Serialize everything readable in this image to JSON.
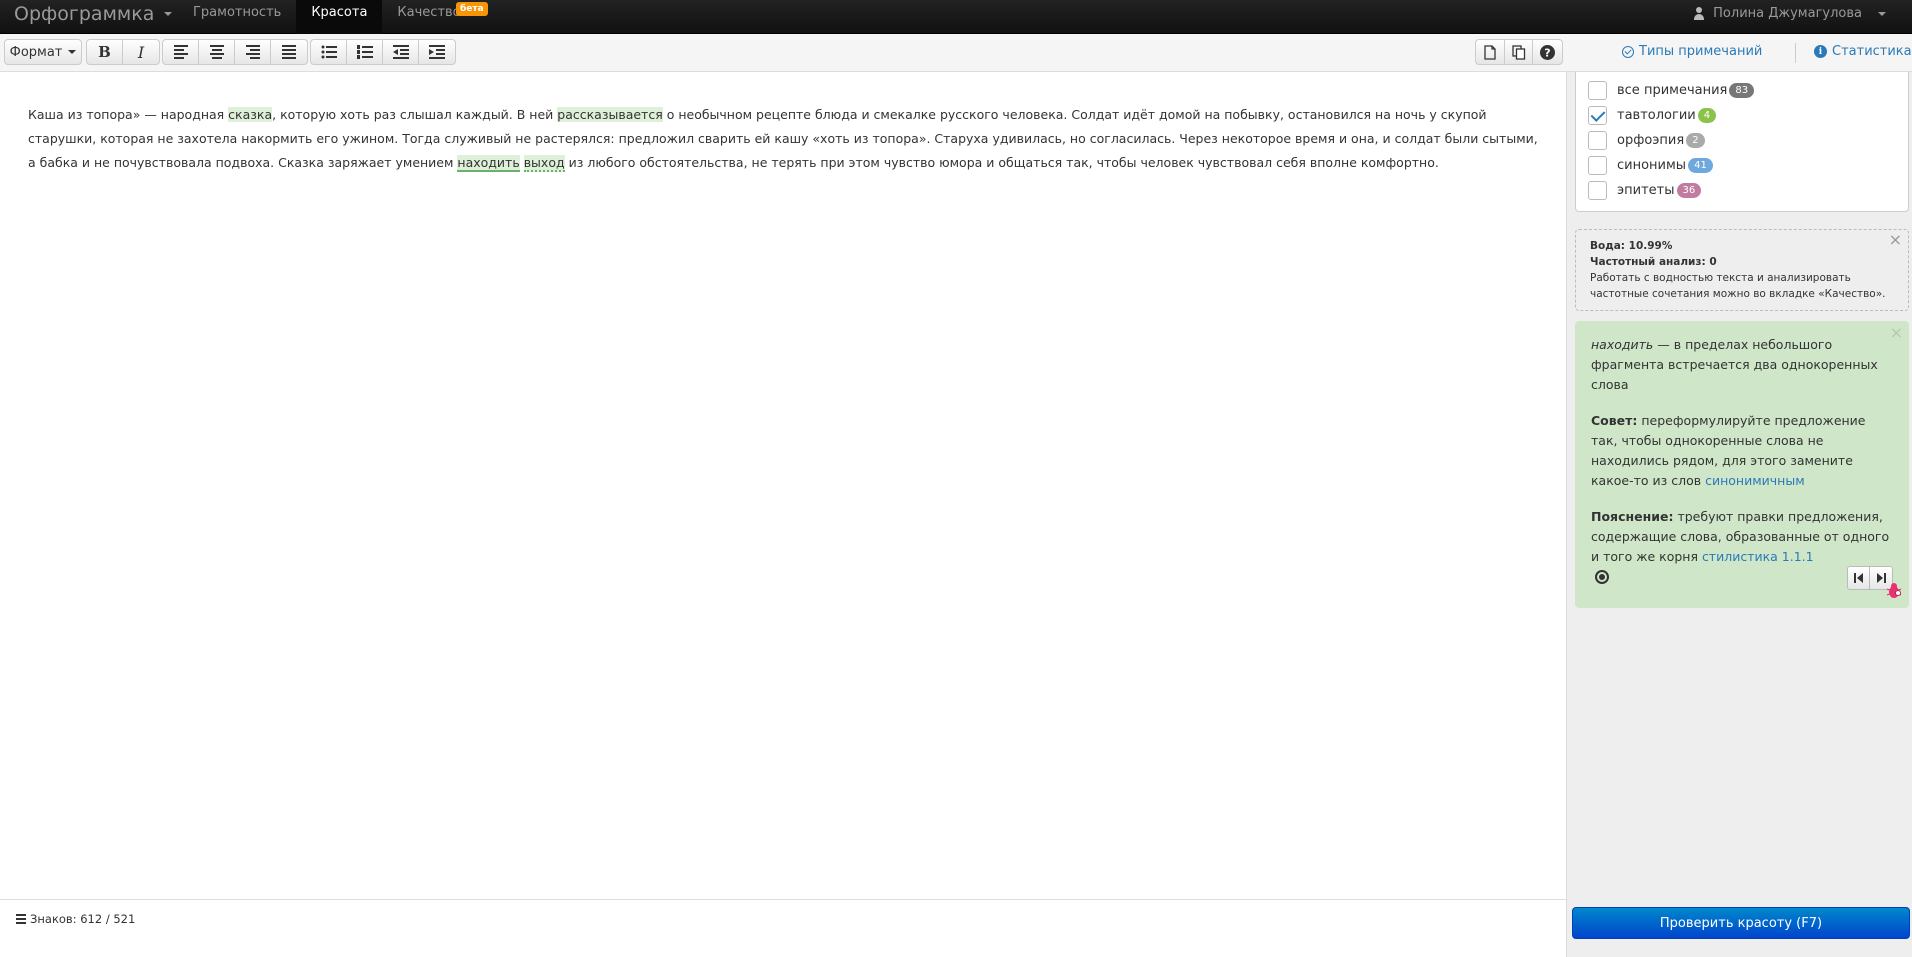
{
  "navbar": {
    "brand": "Орфограммка",
    "tabs": [
      {
        "label": "Грамотность",
        "active": false
      },
      {
        "label": "Красота",
        "active": true
      },
      {
        "label": "Качество",
        "active": false,
        "badge": "бета"
      }
    ],
    "user": "Полина Джумагулова"
  },
  "toolbar": {
    "format_label": "Формат",
    "bold": "B",
    "italic": "I"
  },
  "right_header": {
    "types_label": "Типы примечаний",
    "stats_label": "Статистика"
  },
  "editor": {
    "parts": [
      "Каша из топора» — народная ",
      "сказка",
      ", которую хоть раз слышал каждый. В ней ",
      "рассказывается",
      " о необычном рецепте блюда и смекалке русского человека. Солдат идёт домой на побывку, остановился на ночь у скупой старушки, которая не захотела накормить его ужином. Тогда служивый не растерялся: предложил сварить ей кашу «хоть из топора». Старуха удивилась, но согласилась. Через некоторое время и она, и солдат были сытыми, а бабка и не почувствовала подвоха. Сказка заряжает умением ",
      "находить",
      " ",
      "выход",
      " из любого обстоятельства, не терять при этом чувство юмора и общаться так, чтобы человек чувствовал себя вполне комфортно."
    ]
  },
  "types": [
    {
      "label": "все примечания",
      "count": "83",
      "checked": false,
      "color": "#777777"
    },
    {
      "label": "тавтологии",
      "count": "4",
      "checked": true,
      "color": "#8bc34a"
    },
    {
      "label": "орфоэпия",
      "count": "2",
      "checked": false,
      "color": "#aaaaaa"
    },
    {
      "label": "синонимы",
      "count": "41",
      "checked": false,
      "color": "#6fa8dc"
    },
    {
      "label": "эпитеты",
      "count": "36",
      "checked": false,
      "color": "#c27ba0"
    }
  ],
  "water": {
    "water_line": "Вода: 10.99%",
    "freq_line": "Частотный анализ: 0",
    "note": "Работать с водностью текста и анализировать частотные сочетания можно во вкладке «Качество»."
  },
  "tip": {
    "word": "находить",
    "desc": " — в пределах небольшого фрагмента встречается два однокоренных слова",
    "advice_label": "Совет:",
    "advice_text": " переформулируйте предложение так, чтобы однокоренные слова не находились рядом, для этого замените какое-то из слов ",
    "advice_link": "синонимичным",
    "explain_label": "Пояснение:",
    "explain_text": " требуют правки предложения, содержащие слова, образованные от одного и того же корня ",
    "explain_link": "стилистика 1.1.1"
  },
  "footer": {
    "counter": "Знаков: 612 / 521",
    "check_button": "Проверить красоту (F7)"
  }
}
